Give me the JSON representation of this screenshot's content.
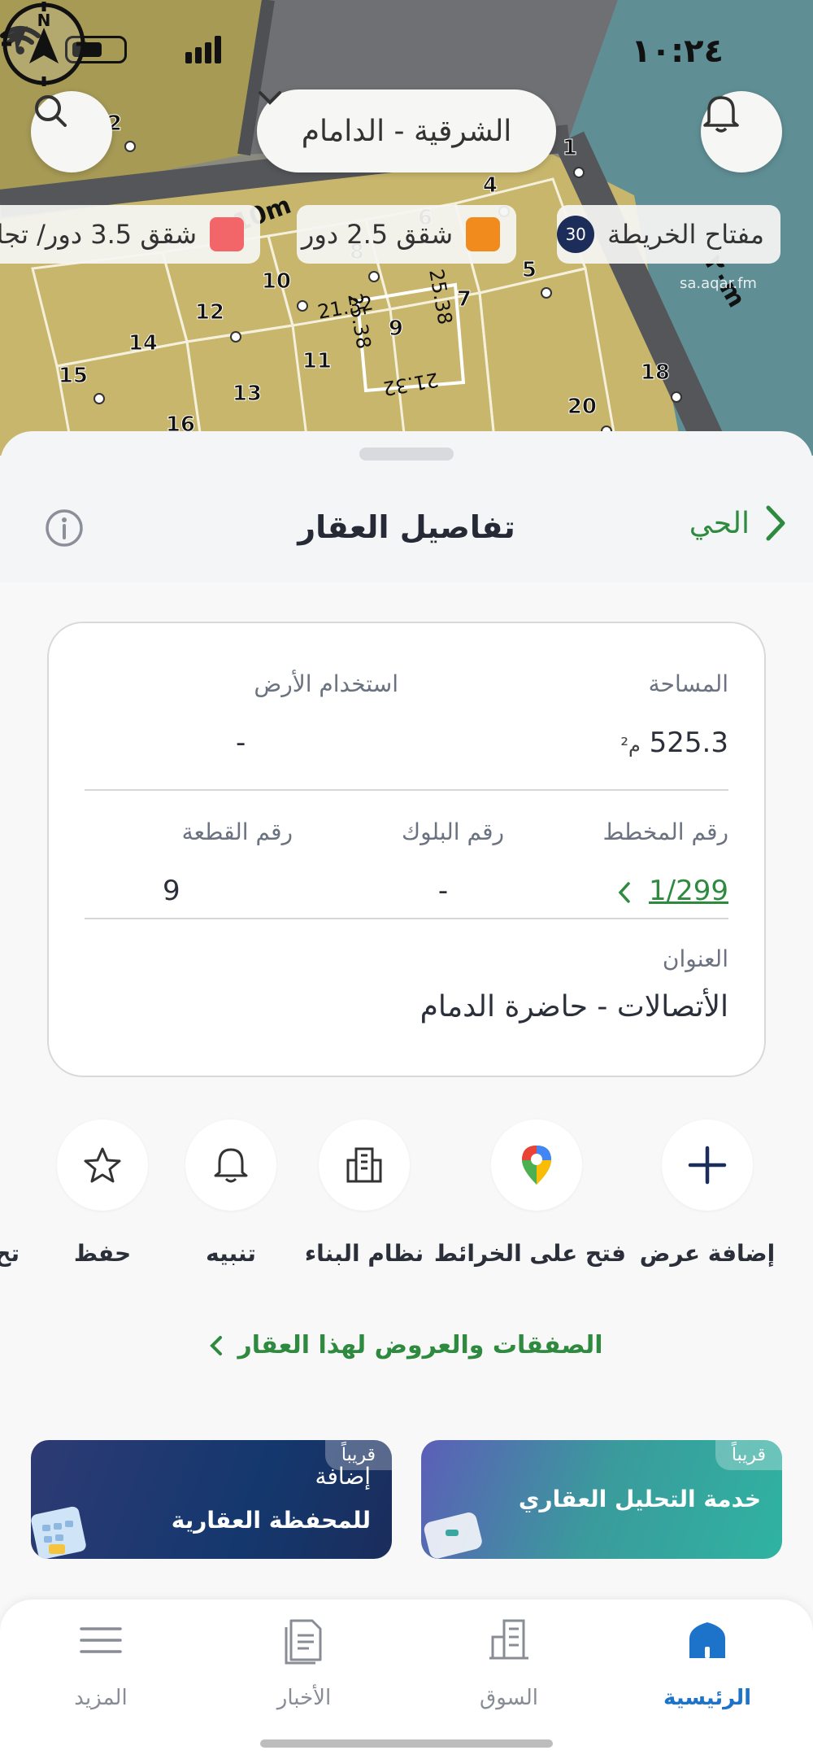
{
  "status_bar": {
    "time": "١٠:٢٤"
  },
  "map": {
    "region": "الشرقية - الدامام",
    "legend": {
      "key_label": "مفتاح الخريطة",
      "key_badge": "30",
      "chips": [
        {
          "label": "شقق 2.5 دور",
          "color": "#f18b1e"
        },
        {
          "label": "شقق 3.5 دور/ تجا",
          "color": "#f2666a"
        }
      ]
    },
    "compass_label": "N",
    "watermark": "sa.aqar.fm",
    "parcel_numbers": [
      "1",
      "2",
      "4",
      "5",
      "6",
      "7",
      "8",
      "9",
      "10",
      "11",
      "12",
      "13",
      "14",
      "15",
      "16",
      "18",
      "20"
    ],
    "dimension_labels": [
      "21.32",
      "25.38",
      "25.38",
      "21.32",
      "10m",
      "٢٠m"
    ]
  },
  "sheet": {
    "back_label": "الحي",
    "title": "تفاصيل العقار",
    "details": {
      "area_label": "المساحة",
      "area_value": "525.3",
      "area_unit": "م²",
      "land_use_label": "استخدام الأرض",
      "land_use_value": "-",
      "plan_label": "رقم المخطط",
      "plan_value": "1/299",
      "block_label": "رقم البلوك",
      "block_value": "-",
      "parcel_label": "رقم القطعة",
      "parcel_value": "9",
      "address_label": "العنوان",
      "address_value": "الأتصالات - حاضرة الدمام"
    },
    "actions": [
      {
        "label": "إضافة عرض",
        "icon": "plus-icon"
      },
      {
        "label": "فتح على الخرائط",
        "icon": "map-pin-icon"
      },
      {
        "label": "نظام البناء",
        "icon": "building-icon"
      },
      {
        "label": "تنبيه",
        "icon": "bell-icon"
      },
      {
        "label": "حفظ",
        "icon": "star-icon"
      },
      {
        "label": "تح",
        "icon": "share-icon"
      }
    ],
    "deals_link": "الصفقات والعروض لهذا العقار",
    "promos": [
      {
        "badge": "قريباً",
        "line1": "خدمة التحليل العقاري"
      },
      {
        "badge": "قريباً",
        "line1": "إضافة",
        "line2": "للمحفظة العقارية"
      }
    ]
  },
  "tabbar": {
    "tabs": [
      {
        "label": "الرئيسية",
        "icon": "home-icon",
        "active": true
      },
      {
        "label": "السوق",
        "icon": "market-icon",
        "active": false
      },
      {
        "label": "الأخبار",
        "icon": "news-icon",
        "active": false
      },
      {
        "label": "المزيد",
        "icon": "menu-icon",
        "active": false
      }
    ]
  },
  "colors": {
    "accent_green": "#2e8a3e",
    "active_tab_blue": "#1c73c9",
    "legend_orange": "#f18b1e",
    "legend_red": "#f2666a"
  }
}
